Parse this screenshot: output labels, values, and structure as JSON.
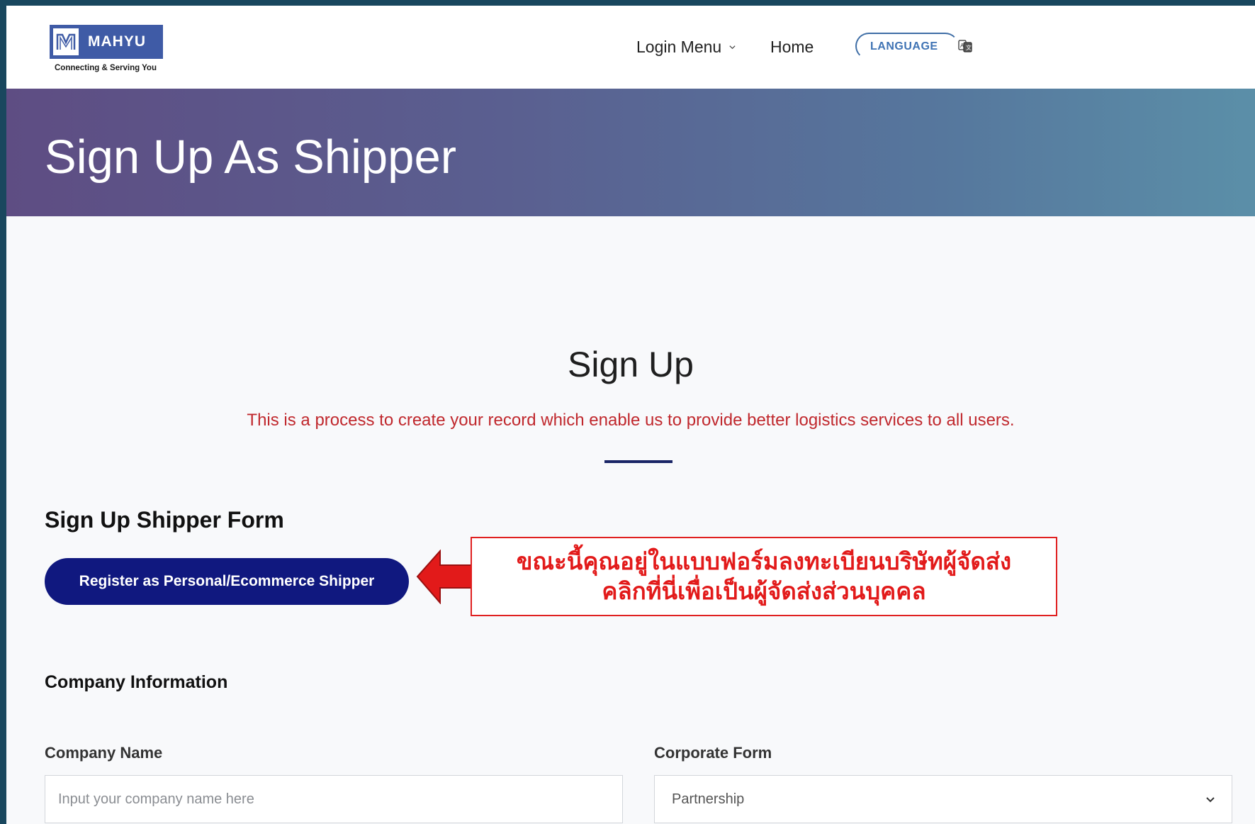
{
  "header": {
    "logo": {
      "name": "MAHYU",
      "tagline": "Connecting & Serving You"
    },
    "nav": {
      "login_menu": "Login Menu",
      "home": "Home"
    },
    "language_label": "LANGUAGE"
  },
  "banner": {
    "title": "Sign Up As Shipper"
  },
  "main": {
    "title": "Sign Up",
    "subtitle": "This is a process to create your record which enable us to provide better logistics services to all users.",
    "form_title": "Sign Up Shipper Form",
    "register_button": "Register as Personal/Ecommerce Shipper",
    "callout": {
      "line1": "ขณะนี้คุณอยู่ในแบบฟอร์มลงทะเบียนบริษัทผู้จัดส่ง",
      "line2": "คลิกที่นี่เพื่อเป็นผู้จัดส่งส่วนบุคคล"
    },
    "section_title": "Company Information",
    "fields": {
      "company_name": {
        "label": "Company Name",
        "placeholder": "Input your company name here",
        "value": ""
      },
      "corporate_form": {
        "label": "Corporate Form",
        "selected": "Partnership"
      }
    }
  },
  "colors": {
    "primary_button": "#10187f",
    "accent_red": "#e21a1a",
    "logo_blue": "#3f5ba6",
    "link_blue": "#3f73b4"
  },
  "icons": [
    "logo-m-icon",
    "chevron-down-icon",
    "translate-icon",
    "red-arrow-icon",
    "select-chevron-icon"
  ]
}
